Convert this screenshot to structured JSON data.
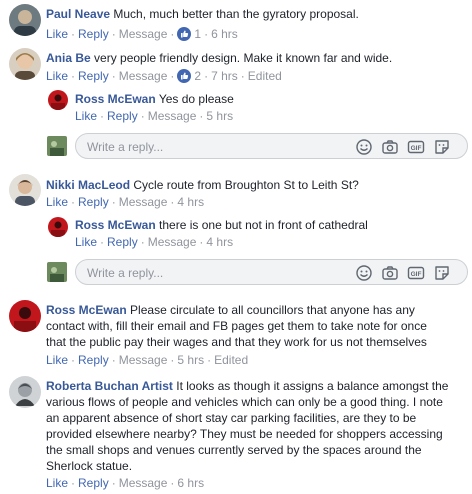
{
  "labels": {
    "like": "Like",
    "reply": "Reply",
    "message": "Message",
    "edited": "Edited",
    "reply_placeholder": "Write a reply..."
  },
  "comments": [
    {
      "name": "Paul Neave",
      "text": "Much, much better than the gyratory proposal.",
      "reactions": "1",
      "time": "6 hrs"
    },
    {
      "name": "Ania Be",
      "text": "very people friendly design. Make it known far and wide.",
      "reactions": "2",
      "time": "7 hrs"
    },
    {
      "name": "Ross McEwan",
      "text": "Yes do please",
      "time": "5 hrs"
    },
    {
      "name": "Nikki MacLeod",
      "text": "Cycle route from Broughton St to Leith St?",
      "time": "4 hrs"
    },
    {
      "name": "Ross McEwan",
      "text": "there is one but not in front of cathedral",
      "time": "4 hrs"
    },
    {
      "name": "Ross McEwan",
      "text_lines": [
        "Please circulate to all councillors that anyone has any",
        "contact with, fill their email and FB pages get them to take note for once",
        "that the public pay their wages and that they work for us not themselves"
      ],
      "time": "5 hrs"
    },
    {
      "name": "Roberta Buchan Artist",
      "text_lines": [
        "It looks as though it assigns a balance amongst the",
        "various flows of people and vehicles which can only be a good thing. I note",
        "an apparent absence of short stay car parking facilities, are they to be",
        "provided elsewhere nearby? They must be needed for shoppers accessing",
        "the small shops and venues currently served by the spaces around the",
        "Sherlock statue."
      ],
      "time": "6 hrs"
    }
  ],
  "colors": {
    "name": "#385898",
    "link": "#4267b2",
    "muted": "#90949c",
    "like_blue": "#4267b2",
    "love_red": "#f25268"
  },
  "icons": [
    "like-reaction-icon",
    "love-reaction-icon",
    "emoji-icon",
    "camera-icon",
    "gif-icon",
    "sticker-icon"
  ]
}
